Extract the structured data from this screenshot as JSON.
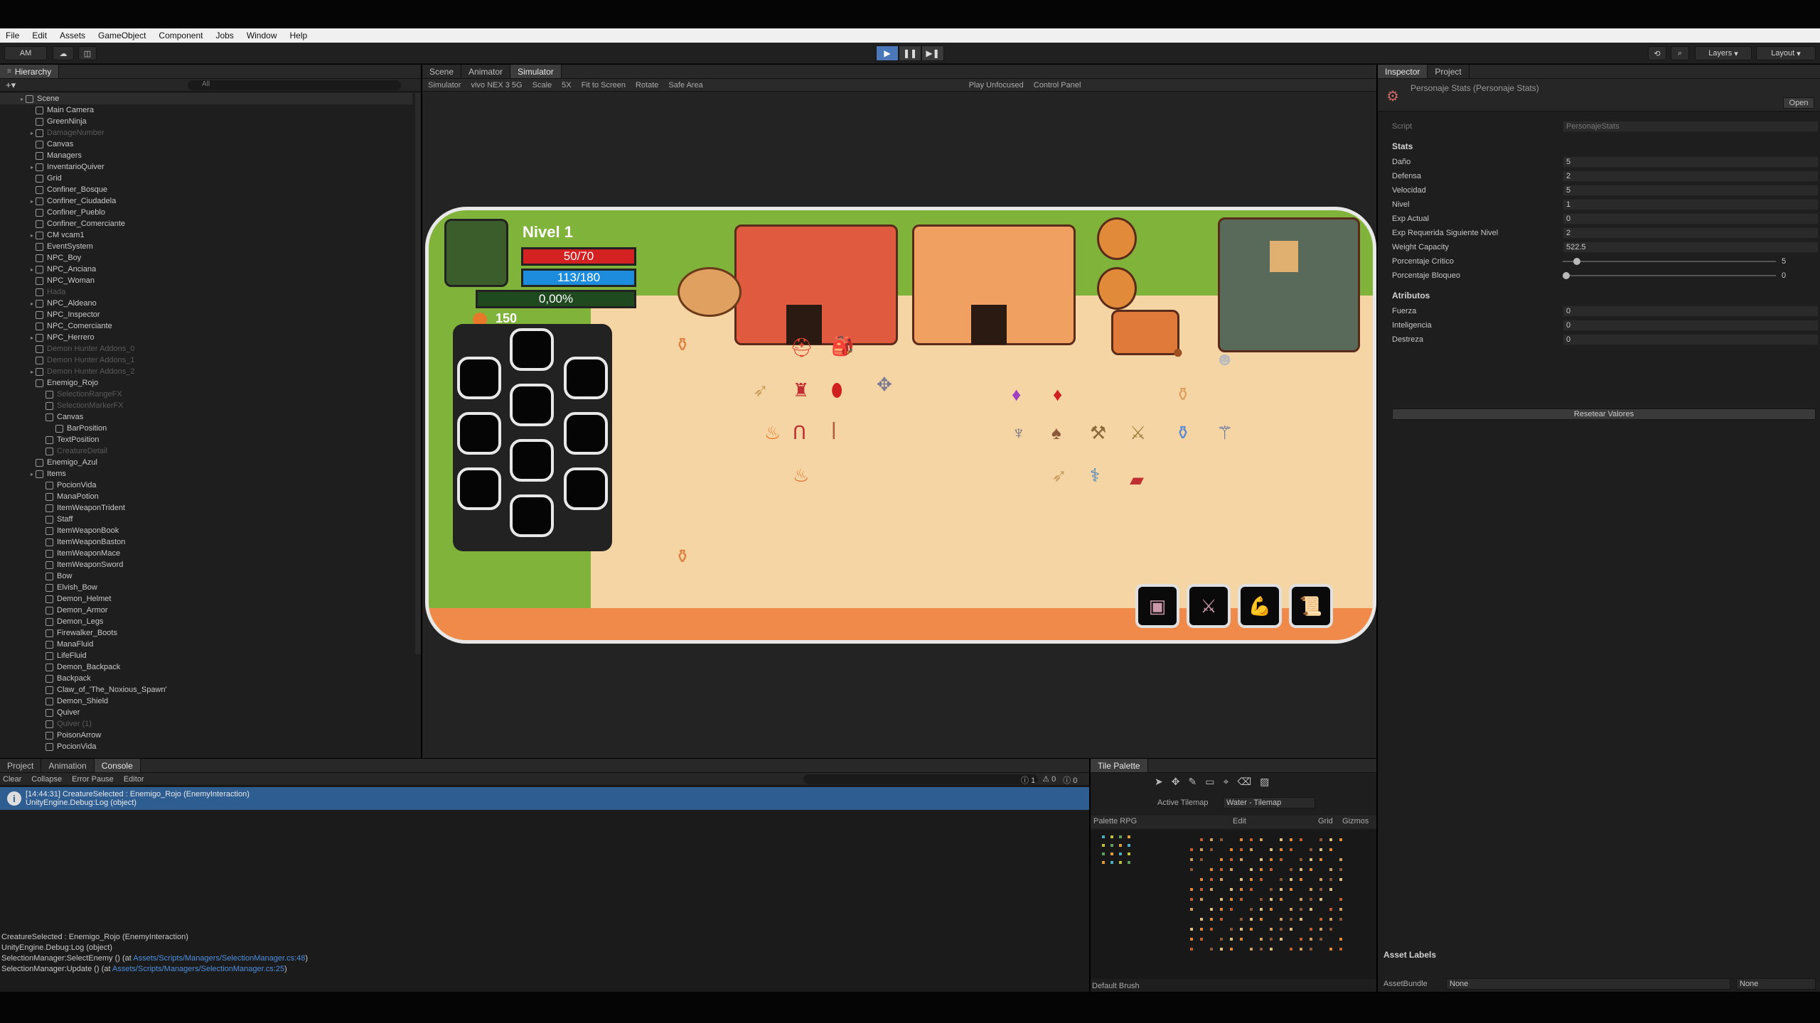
{
  "menu": [
    "File",
    "Edit",
    "Assets",
    "GameObject",
    "Component",
    "Jobs",
    "Window",
    "Help"
  ],
  "toolbar": {
    "account": "AM",
    "layers": "Layers",
    "layout": "Layout"
  },
  "hierarchy": {
    "title": "Hierarchy",
    "search_placeholder": "All",
    "items": [
      {
        "label": "Scene",
        "depth": 0,
        "dim": false,
        "root": true
      },
      {
        "label": "Main Camera",
        "depth": 1,
        "dim": false
      },
      {
        "label": "GreenNinja",
        "depth": 1,
        "dim": false
      },
      {
        "label": "DamageNumber",
        "depth": 1,
        "dim": true
      },
      {
        "label": "Canvas",
        "depth": 1,
        "dim": false
      },
      {
        "label": "Managers",
        "depth": 1,
        "dim": false
      },
      {
        "label": "InventarioQuiver",
        "depth": 1,
        "dim": false
      },
      {
        "label": "Grid",
        "depth": 1,
        "dim": false
      },
      {
        "label": "Confiner_Bosque",
        "depth": 1,
        "dim": false
      },
      {
        "label": "Confiner_Ciudadela",
        "depth": 1,
        "dim": false
      },
      {
        "label": "Confiner_Pueblo",
        "depth": 1,
        "dim": false
      },
      {
        "label": "Confiner_Comerciante",
        "depth": 1,
        "dim": false
      },
      {
        "label": "CM vcam1",
        "depth": 1,
        "dim": false
      },
      {
        "label": "EventSystem",
        "depth": 1,
        "dim": false
      },
      {
        "label": "NPC_Boy",
        "depth": 1,
        "dim": false
      },
      {
        "label": "NPC_Anciana",
        "depth": 1,
        "dim": false
      },
      {
        "label": "NPC_Woman",
        "depth": 1,
        "dim": false
      },
      {
        "label": "Hada",
        "depth": 1,
        "dim": true
      },
      {
        "label": "NPC_Aldeano",
        "depth": 1,
        "dim": false
      },
      {
        "label": "NPC_Inspector",
        "depth": 1,
        "dim": false
      },
      {
        "label": "NPC_Comerciante",
        "depth": 1,
        "dim": false
      },
      {
        "label": "NPC_Herrero",
        "depth": 1,
        "dim": false
      },
      {
        "label": "Demon Hunter Addons_0",
        "depth": 1,
        "dim": true
      },
      {
        "label": "Demon Hunter Addons_1",
        "depth": 1,
        "dim": true
      },
      {
        "label": "Demon Hunter Addons_2",
        "depth": 1,
        "dim": true
      },
      {
        "label": "Enemigo_Rojo",
        "depth": 1,
        "dim": false
      },
      {
        "label": "SelectionRangeFX",
        "depth": 2,
        "dim": true
      },
      {
        "label": "SelectionMarkerFX",
        "depth": 2,
        "dim": true
      },
      {
        "label": "Canvas",
        "depth": 2,
        "dim": false
      },
      {
        "label": "BarPosition",
        "depth": 3,
        "dim": false
      },
      {
        "label": "TextPosition",
        "depth": 2,
        "dim": false
      },
      {
        "label": "CreatureDetail",
        "depth": 2,
        "dim": true
      },
      {
        "label": "Enemigo_Azul",
        "depth": 1,
        "dim": false
      },
      {
        "label": "Items",
        "depth": 1,
        "dim": false
      },
      {
        "label": "PocionVida",
        "depth": 2,
        "dim": false
      },
      {
        "label": "ManaPotion",
        "depth": 2,
        "dim": false
      },
      {
        "label": "ItemWeaponTrident",
        "depth": 2,
        "dim": false
      },
      {
        "label": "Staff",
        "depth": 2,
        "dim": false
      },
      {
        "label": "ItemWeaponBook",
        "depth": 2,
        "dim": false
      },
      {
        "label": "ItemWeaponBaston",
        "depth": 2,
        "dim": false
      },
      {
        "label": "ItemWeaponMace",
        "depth": 2,
        "dim": false
      },
      {
        "label": "ItemWeaponSword",
        "depth": 2,
        "dim": false
      },
      {
        "label": "Bow",
        "depth": 2,
        "dim": false
      },
      {
        "label": "Elvish_Bow",
        "depth": 2,
        "dim": false
      },
      {
        "label": "Demon_Helmet",
        "depth": 2,
        "dim": false
      },
      {
        "label": "Demon_Armor",
        "depth": 2,
        "dim": false
      },
      {
        "label": "Demon_Legs",
        "depth": 2,
        "dim": false
      },
      {
        "label": "Firewalker_Boots",
        "depth": 2,
        "dim": false
      },
      {
        "label": "ManaFluid",
        "depth": 2,
        "dim": false
      },
      {
        "label": "LifeFluid",
        "depth": 2,
        "dim": false
      },
      {
        "label": "Demon_Backpack",
        "depth": 2,
        "dim": false
      },
      {
        "label": "Backpack",
        "depth": 2,
        "dim": false
      },
      {
        "label": "Claw_of_'The_Noxious_Spawn'",
        "depth": 2,
        "dim": false
      },
      {
        "label": "Demon_Shield",
        "depth": 2,
        "dim": false
      },
      {
        "label": "Quiver",
        "depth": 2,
        "dim": false
      },
      {
        "label": "Quiver (1)",
        "depth": 2,
        "dim": true
      },
      {
        "label": "PoisonArrow",
        "depth": 2,
        "dim": false
      },
      {
        "label": "PocionVida",
        "depth": 2,
        "dim": false
      }
    ]
  },
  "center": {
    "tabs": [
      "Scene",
      "Animator",
      "Simulator"
    ],
    "simbar": [
      "Simulator",
      "vivo NEX 3 5G",
      "Scale",
      "5X",
      "Fit to Screen",
      "Rotate",
      "Safe Area",
      "Play Unfocused",
      "Control Panel"
    ]
  },
  "game": {
    "level": "Nivel 1",
    "hp": "50/70",
    "hp_fraction": 0.714,
    "mana": "113/180",
    "mana_fraction": 0.628,
    "xp": "0,00%",
    "coins": "150"
  },
  "inspector": {
    "tabs": [
      "Inspector",
      "Project"
    ],
    "component": "Personaje Stats (Personaje Stats)",
    "open_label": "Open",
    "script_label": "Script",
    "script_value": "PersonajeStats",
    "stats_header": "Stats",
    "stats": [
      {
        "label": "Daño",
        "value": "5"
      },
      {
        "label": "Defensa",
        "value": "2"
      },
      {
        "label": "Velocidad",
        "value": "5"
      },
      {
        "label": "Nivel",
        "value": "1"
      },
      {
        "label": "Exp Actual",
        "value": "0"
      },
      {
        "label": "Exp Requerida Siguiente Nivel",
        "value": "2"
      },
      {
        "label": "Weight Capacity",
        "value": "522.5"
      }
    ],
    "sliders": [
      {
        "label": "Porcentaje Critico",
        "value": "5",
        "fraction": 0.05
      },
      {
        "label": "Porcentaje Bloqueo",
        "value": "0",
        "fraction": 0.0
      }
    ],
    "attr_header": "Atributos",
    "attributes": [
      {
        "label": "Fuerza",
        "value": "0"
      },
      {
        "label": "Inteligencia",
        "value": "0"
      },
      {
        "label": "Destreza",
        "value": "0"
      }
    ],
    "reset_label": "Resetear Valores",
    "asset_labels": "Asset Labels",
    "asset_bundle": "AssetBundle",
    "none1": "None",
    "none2": "None"
  },
  "console": {
    "tabs": [
      "Project",
      "Animation",
      "Console"
    ],
    "toolbar": [
      "Clear",
      "Collapse",
      "Error Pause",
      "Editor"
    ],
    "counts": [
      "1",
      "0",
      "0"
    ],
    "selected_line1": "[14:44:31] CreatureSelected : Enemigo_Rojo (EnemyInteraction)",
    "selected_line2": "UnityEngine.Debug:Log (object)",
    "detail": [
      "CreatureSelected : Enemigo_Rojo (EnemyInteraction)",
      "UnityEngine.Debug:Log (object)",
      "SelectionManager:SelectEnemy () (at ",
      "SelectionManager:Update () (at "
    ],
    "links": [
      "Assets/Scripts/Managers/SelectionManager.cs:48",
      "Assets/Scripts/Managers/SelectionManager.cs:25"
    ]
  },
  "tilepalette": {
    "title": "Tile Palette",
    "active_tilemap_label": "Active Tilemap",
    "active_tilemap": "Water - Tilemap",
    "palette": "Palette RPG",
    "edit": "Edit",
    "grid": "Grid",
    "gizmos": "Gizmos",
    "brush": "Default Brush"
  },
  "colors": {
    "accent": "#2e5d92",
    "hp": "#d42222",
    "mana": "#1e8cdc",
    "grass": "#7fb33a",
    "floor": "#f5d5a4"
  }
}
